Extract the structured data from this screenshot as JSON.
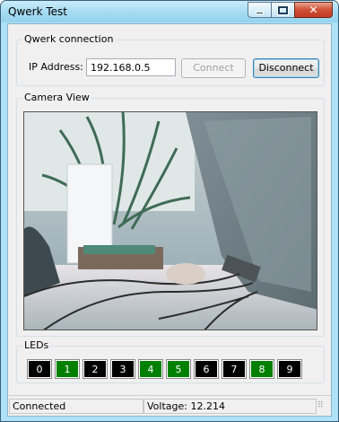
{
  "window": {
    "title": "Qwerk Test",
    "caption": {
      "minimize": "minimize",
      "maximize": "maximize",
      "close": "✕"
    }
  },
  "connection": {
    "group_label": "Qwerk connection",
    "ip_label": "IP Address:",
    "ip_value": "192.168.0.5",
    "connect_label": "Connect",
    "connect_enabled": false,
    "disconnect_label": "Disconnect"
  },
  "camera": {
    "group_label": "Camera View"
  },
  "leds": {
    "group_label": "LEDs",
    "items": [
      {
        "label": "0",
        "on": false
      },
      {
        "label": "1",
        "on": true
      },
      {
        "label": "2",
        "on": false
      },
      {
        "label": "3",
        "on": false
      },
      {
        "label": "4",
        "on": true
      },
      {
        "label": "5",
        "on": true
      },
      {
        "label": "6",
        "on": false
      },
      {
        "label": "7",
        "on": false
      },
      {
        "label": "8",
        "on": true
      },
      {
        "label": "9",
        "on": false
      }
    ],
    "on_color": "#008000",
    "off_color": "#000000"
  },
  "status": {
    "connection": "Connected",
    "voltage": "Voltage: 12.214"
  }
}
